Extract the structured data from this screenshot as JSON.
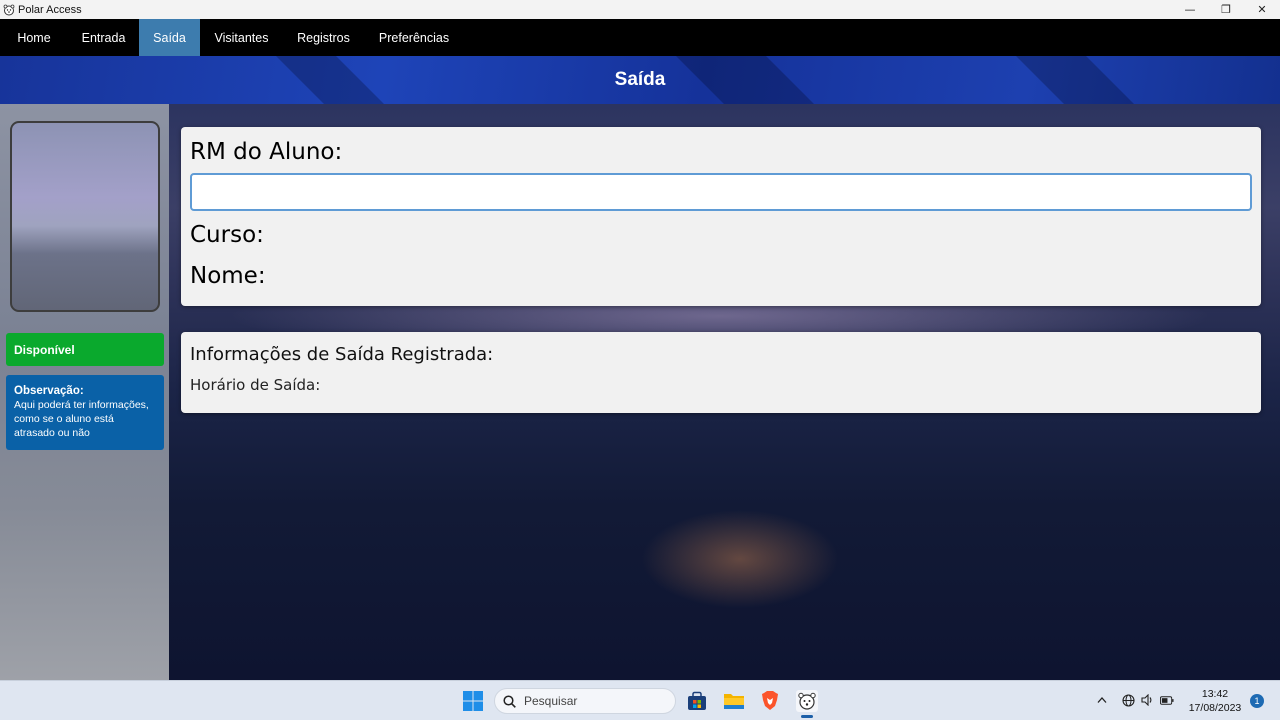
{
  "window": {
    "title": "Polar Access",
    "controls": {
      "minimize": "—",
      "restore": "❐",
      "close": "✕"
    }
  },
  "menu": {
    "items": [
      {
        "label": "Home",
        "active": false
      },
      {
        "label": "Entrada",
        "active": false
      },
      {
        "label": "Saída",
        "active": true
      },
      {
        "label": "Visitantes",
        "active": false
      },
      {
        "label": "Registros",
        "active": false
      },
      {
        "label": "Preferências",
        "active": false
      }
    ]
  },
  "header": {
    "title": "Saída"
  },
  "sidebar": {
    "status": "Disponível",
    "observation": {
      "title": "Observação:",
      "text": "Aqui poderá ter informações, como se o aluno está atrasado ou não"
    }
  },
  "student_card": {
    "rm_label": "RM do Aluno:",
    "rm_value": "",
    "course_label": "Curso:",
    "name_label": "Nome:"
  },
  "exit_card": {
    "title": "Informações de Saída Registrada:",
    "time_label": "Horário de Saída:"
  },
  "taskbar": {
    "search_placeholder": "Pesquisar",
    "time": "13:42",
    "date": "17/08/2023",
    "notification_count": "1"
  },
  "colors": {
    "menu_active": "#3d7cae",
    "status_available": "#0aa92d",
    "observation_bg": "#0a61a7",
    "input_border": "#5f9bd5"
  }
}
